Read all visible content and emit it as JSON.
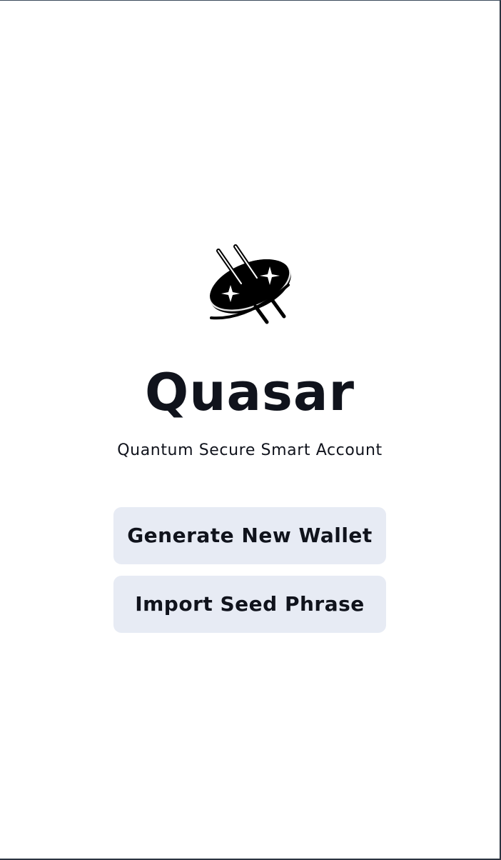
{
  "app": {
    "title": "Quasar",
    "subtitle": "Quantum Secure Smart Account",
    "logo_icon": "quasar-logo-icon"
  },
  "actions": {
    "generate_label": "Generate New Wallet",
    "import_label": "Import Seed Phrase"
  },
  "colors": {
    "text": "#10131c",
    "button_bg": "#e7ebf4",
    "background": "#ffffff"
  }
}
